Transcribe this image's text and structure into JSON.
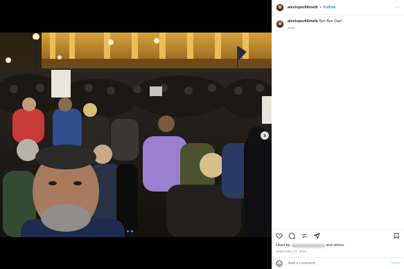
{
  "post": {
    "username": "alexlopez66melb",
    "separator": "•",
    "follow_label": "Follow",
    "more_label": "···",
    "caption_username": "alexlopez66melb",
    "caption_text": " Bye Bye Dan!",
    "caption_time": "150w",
    "likes_prefix": "Liked by",
    "likes_suffix": "and others",
    "date": "September 27, 2021",
    "comment_placeholder": "Add a comment...",
    "post_label": "Post"
  },
  "icons": {
    "like": "heart-icon",
    "comment": "comment-icon",
    "share": "share-icon",
    "send": "send-icon",
    "save": "bookmark-icon",
    "emoji": "emoji-icon",
    "next": "chevron-right-icon"
  },
  "colors": {
    "accent": "#0095f6",
    "post_disabled": "#b2dffc",
    "carousel_active": "#3897f0"
  }
}
